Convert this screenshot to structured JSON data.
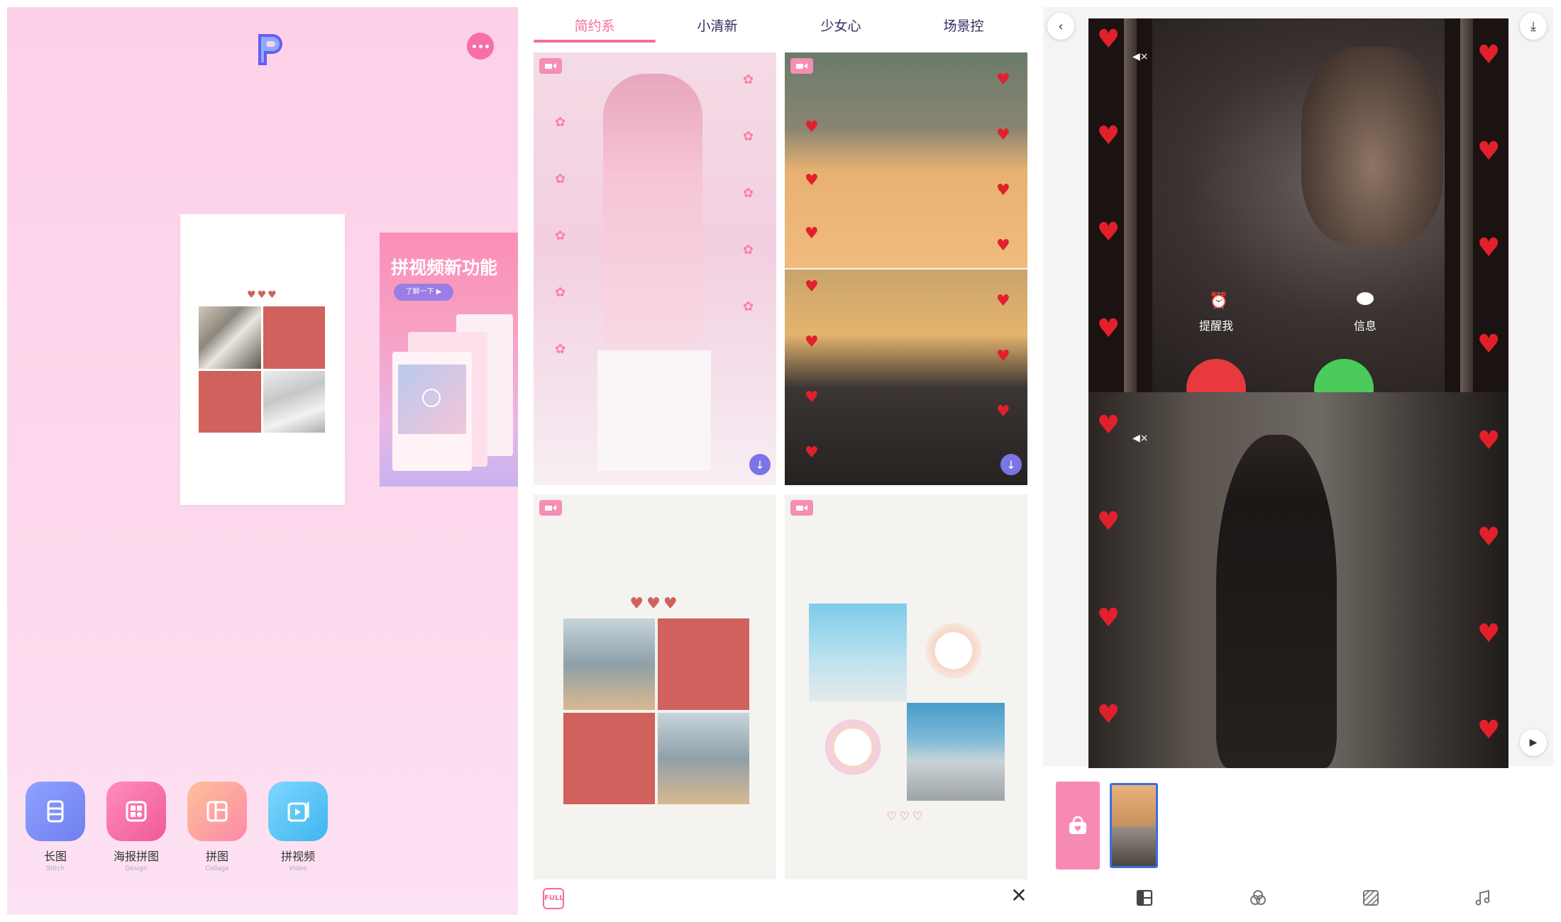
{
  "home": {
    "promo_title": "拼视频新功能",
    "promo_button": "了解一下 ▶",
    "tools": [
      {
        "label": "长图",
        "sub": "Stitch",
        "color": "#7d8ef3"
      },
      {
        "label": "海报拼图",
        "sub": "Design",
        "color": "#f46ba1"
      },
      {
        "label": "拼图",
        "sub": "Collage",
        "color": "#fc9ea2"
      },
      {
        "label": "拼视频",
        "sub": "Video",
        "color": "#55c5f4"
      }
    ]
  },
  "gallery": {
    "tabs": [
      "简约系",
      "小清新",
      "少女心",
      "场景控"
    ],
    "active_tab": "简约系",
    "footer_left": "FULL"
  },
  "editor": {
    "call_remind": "提醒我",
    "call_message": "信息"
  },
  "colors": {
    "accent_pink": "#f36b9f",
    "tab_text": "#2f2f5f",
    "download_purple": "#7b74e6",
    "collage_red": "#d0615c"
  }
}
